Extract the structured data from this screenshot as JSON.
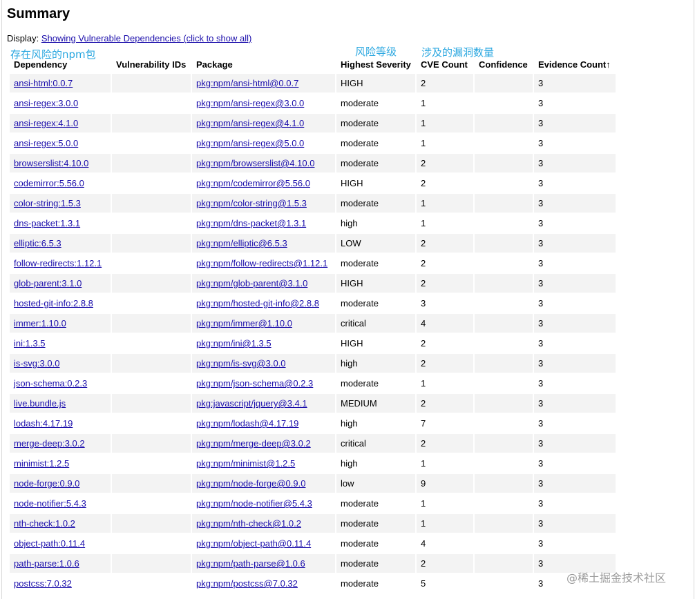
{
  "page": {
    "title": "Summary",
    "display_prefix": "Display: ",
    "display_link": "Showing Vulnerable Dependencies (click to show all)"
  },
  "annotations": {
    "npm_package": "存在风险的npm包",
    "risk_level": "风险等级",
    "vuln_count": "涉及的漏洞数量"
  },
  "table": {
    "headers": {
      "dependency": "Dependency",
      "vulnerability_ids": "Vulnerability IDs",
      "package": "Package",
      "highest_severity": "Highest Severity",
      "cve_count": "CVE Count",
      "confidence": "Confidence",
      "evidence_count": "Evidence Count↑"
    },
    "rows": [
      {
        "dependency": "ansi-html:0.0.7",
        "package": "pkg:npm/ansi-html@0.0.7",
        "severity": "HIGH",
        "cve": "2",
        "confidence": "",
        "evidence": "3"
      },
      {
        "dependency": "ansi-regex:3.0.0",
        "package": "pkg:npm/ansi-regex@3.0.0",
        "severity": "moderate",
        "cve": "1",
        "confidence": "",
        "evidence": "3"
      },
      {
        "dependency": "ansi-regex:4.1.0",
        "package": "pkg:npm/ansi-regex@4.1.0",
        "severity": "moderate",
        "cve": "1",
        "confidence": "",
        "evidence": "3"
      },
      {
        "dependency": "ansi-regex:5.0.0",
        "package": "pkg:npm/ansi-regex@5.0.0",
        "severity": "moderate",
        "cve": "1",
        "confidence": "",
        "evidence": "3"
      },
      {
        "dependency": "browserslist:4.10.0",
        "package": "pkg:npm/browserslist@4.10.0",
        "severity": "moderate",
        "cve": "2",
        "confidence": "",
        "evidence": "3"
      },
      {
        "dependency": "codemirror:5.56.0",
        "package": "pkg:npm/codemirror@5.56.0",
        "severity": "HIGH",
        "cve": "2",
        "confidence": "",
        "evidence": "3"
      },
      {
        "dependency": "color-string:1.5.3",
        "package": "pkg:npm/color-string@1.5.3",
        "severity": "moderate",
        "cve": "1",
        "confidence": "",
        "evidence": "3"
      },
      {
        "dependency": "dns-packet:1.3.1",
        "package": "pkg:npm/dns-packet@1.3.1",
        "severity": "high",
        "cve": "1",
        "confidence": "",
        "evidence": "3"
      },
      {
        "dependency": "elliptic:6.5.3",
        "package": "pkg:npm/elliptic@6.5.3",
        "severity": "LOW",
        "cve": "2",
        "confidence": "",
        "evidence": "3"
      },
      {
        "dependency": "follow-redirects:1.12.1",
        "package": "pkg:npm/follow-redirects@1.12.1",
        "severity": "moderate",
        "cve": "2",
        "confidence": "",
        "evidence": "3"
      },
      {
        "dependency": "glob-parent:3.1.0",
        "package": "pkg:npm/glob-parent@3.1.0",
        "severity": "HIGH",
        "cve": "2",
        "confidence": "",
        "evidence": "3"
      },
      {
        "dependency": "hosted-git-info:2.8.8",
        "package": "pkg:npm/hosted-git-info@2.8.8",
        "severity": "moderate",
        "cve": "3",
        "confidence": "",
        "evidence": "3"
      },
      {
        "dependency": "immer:1.10.0",
        "package": "pkg:npm/immer@1.10.0",
        "severity": "critical",
        "cve": "4",
        "confidence": "",
        "evidence": "3"
      },
      {
        "dependency": "ini:1.3.5",
        "package": "pkg:npm/ini@1.3.5",
        "severity": "HIGH",
        "cve": "2",
        "confidence": "",
        "evidence": "3"
      },
      {
        "dependency": "is-svg:3.0.0",
        "package": "pkg:npm/is-svg@3.0.0",
        "severity": "high",
        "cve": "2",
        "confidence": "",
        "evidence": "3"
      },
      {
        "dependency": "json-schema:0.2.3",
        "package": "pkg:npm/json-schema@0.2.3",
        "severity": "moderate",
        "cve": "1",
        "confidence": "",
        "evidence": "3"
      },
      {
        "dependency": "live.bundle.js",
        "package": "pkg:javascript/jquery@3.4.1",
        "severity": "MEDIUM",
        "cve": "2",
        "confidence": "",
        "evidence": "3"
      },
      {
        "dependency": "lodash:4.17.19",
        "package": "pkg:npm/lodash@4.17.19",
        "severity": "high",
        "cve": "7",
        "confidence": "",
        "evidence": "3"
      },
      {
        "dependency": "merge-deep:3.0.2",
        "package": "pkg:npm/merge-deep@3.0.2",
        "severity": "critical",
        "cve": "2",
        "confidence": "",
        "evidence": "3"
      },
      {
        "dependency": "minimist:1.2.5",
        "package": "pkg:npm/minimist@1.2.5",
        "severity": "high",
        "cve": "1",
        "confidence": "",
        "evidence": "3"
      },
      {
        "dependency": "node-forge:0.9.0",
        "package": "pkg:npm/node-forge@0.9.0",
        "severity": "low",
        "cve": "9",
        "confidence": "",
        "evidence": "3"
      },
      {
        "dependency": "node-notifier:5.4.3",
        "package": "pkg:npm/node-notifier@5.4.3",
        "severity": "moderate",
        "cve": "1",
        "confidence": "",
        "evidence": "3"
      },
      {
        "dependency": "nth-check:1.0.2",
        "package": "pkg:npm/nth-check@1.0.2",
        "severity": "moderate",
        "cve": "1",
        "confidence": "",
        "evidence": "3"
      },
      {
        "dependency": "object-path:0.11.4",
        "package": "pkg:npm/object-path@0.11.4",
        "severity": "moderate",
        "cve": "4",
        "confidence": "",
        "evidence": "3"
      },
      {
        "dependency": "path-parse:1.0.6",
        "package": "pkg:npm/path-parse@1.0.6",
        "severity": "moderate",
        "cve": "2",
        "confidence": "",
        "evidence": "3"
      },
      {
        "dependency": "postcss:7.0.32",
        "package": "pkg:npm/postcss@7.0.32",
        "severity": "moderate",
        "cve": "5",
        "confidence": "",
        "evidence": "3"
      }
    ]
  },
  "watermark": "@稀土掘金技术社区"
}
